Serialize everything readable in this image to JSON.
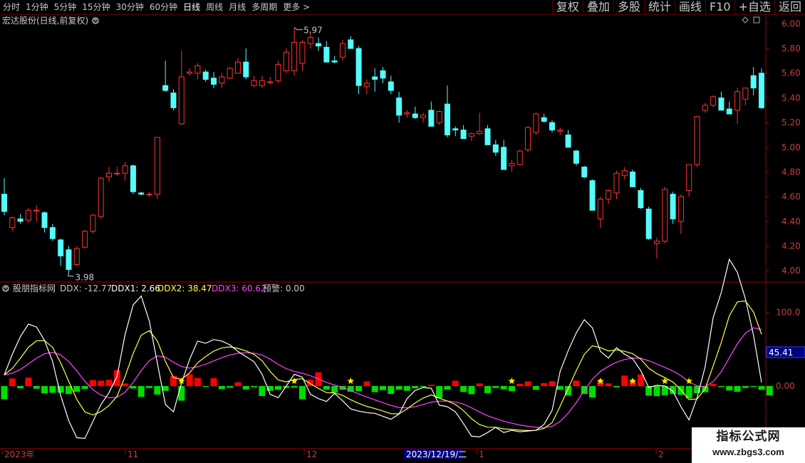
{
  "toolbar": {
    "periods": [
      "分时",
      "1分钟",
      "5分钟",
      "15分钟",
      "30分钟",
      "60分钟",
      "日线",
      "周线",
      "月线",
      "多周期",
      "更多"
    ],
    "active_period": "日线",
    "right_buttons": [
      "复权",
      "叠加",
      "多股",
      "统计",
      "画线",
      "F10",
      "+自选",
      "返回"
    ]
  },
  "stock_title": "宏达股份(日线,前复权)",
  "indicator": {
    "name": "股朋指标网",
    "ddx_label": "DDX: -12.77",
    "ddx1_label": "DDX1: 2.66",
    "ddx2_label": "DDX2: 38.47",
    "ddx3_label": "DDX3: 60.62",
    "alert_label": "预警: 0.00",
    "current_value": "45.41"
  },
  "colors": {
    "up": "#ff3232",
    "down": "#54fcfc",
    "ddx1": "#ffffff",
    "ddx2": "#ffff44",
    "ddx3": "#ff44ff",
    "bar_up": "#ff0000",
    "bar_down": "#00dd00",
    "axis": "#a00000"
  },
  "price_axis": [
    "6.00",
    "5.80",
    "5.60",
    "5.40",
    "5.20",
    "5.00",
    "4.80",
    "4.60",
    "4.40",
    "4.20",
    "4.00"
  ],
  "indicator_axis": [
    "100.0",
    "0.00"
  ],
  "annotations": {
    "high": "5.97",
    "low": "3.98"
  },
  "date_axis": {
    "labels": [
      "2023年",
      "11",
      "12",
      "1",
      "2"
    ],
    "cursor_date": "2023/12/19/二"
  },
  "watermark": {
    "line1": "指标公式网",
    "line2": "www.zbgs3.com"
  },
  "chart_data": [
    {
      "type": "candlestick",
      "title": "宏达股份(日线,前复权)",
      "ylim": [
        3.92,
        6.06
      ],
      "candles": [
        [
          4.62,
          4.75,
          4.45,
          4.48
        ],
        [
          4.35,
          4.44,
          4.32,
          4.43
        ],
        [
          4.42,
          4.46,
          4.38,
          4.4
        ],
        [
          4.41,
          4.51,
          4.39,
          4.49
        ],
        [
          4.49,
          4.53,
          4.4,
          4.49
        ],
        [
          4.47,
          4.48,
          4.31,
          4.35
        ],
        [
          4.35,
          4.38,
          4.24,
          4.26
        ],
        [
          4.25,
          4.26,
          4.04,
          4.12
        ],
        [
          4.17,
          4.2,
          3.98,
          4.01
        ],
        [
          4.05,
          4.2,
          4.04,
          4.18
        ],
        [
          4.19,
          4.33,
          4.18,
          4.32
        ],
        [
          4.32,
          4.46,
          4.3,
          4.45
        ],
        [
          4.44,
          4.76,
          4.42,
          4.75
        ],
        [
          4.76,
          4.84,
          4.72,
          4.79
        ],
        [
          4.79,
          4.84,
          4.77,
          4.79
        ],
        [
          4.79,
          4.88,
          4.73,
          4.85
        ],
        [
          4.85,
          4.86,
          4.62,
          4.64
        ],
        [
          4.63,
          4.64,
          4.61,
          4.62
        ],
        [
          4.62,
          4.64,
          4.6,
          4.62
        ],
        [
          4.62,
          5.08,
          4.58,
          5.08
        ],
        [
          5.5,
          5.7,
          5.45,
          5.46
        ],
        [
          5.44,
          5.47,
          5.3,
          5.32
        ],
        [
          5.19,
          5.78,
          5.18,
          5.57
        ],
        [
          5.6,
          5.64,
          5.58,
          5.61
        ],
        [
          5.6,
          5.68,
          5.55,
          5.66
        ],
        [
          5.61,
          5.63,
          5.53,
          5.55
        ],
        [
          5.56,
          5.61,
          5.48,
          5.51
        ],
        [
          5.52,
          5.6,
          5.48,
          5.57
        ],
        [
          5.56,
          5.65,
          5.55,
          5.64
        ],
        [
          5.6,
          5.72,
          5.6,
          5.69
        ],
        [
          5.69,
          5.8,
          5.55,
          5.57
        ],
        [
          5.5,
          5.58,
          5.49,
          5.54
        ],
        [
          5.5,
          5.58,
          5.48,
          5.54
        ],
        [
          5.53,
          5.57,
          5.51,
          5.53
        ],
        [
          5.54,
          5.7,
          5.52,
          5.67
        ],
        [
          5.62,
          5.8,
          5.6,
          5.77
        ],
        [
          5.62,
          5.97,
          5.58,
          5.85
        ],
        [
          5.68,
          5.87,
          5.62,
          5.85
        ],
        [
          5.84,
          5.94,
          5.8,
          5.89
        ],
        [
          5.84,
          5.89,
          5.78,
          5.82
        ],
        [
          5.81,
          5.86,
          5.71,
          5.69
        ],
        [
          5.7,
          5.74,
          5.68,
          5.69
        ],
        [
          5.73,
          5.87,
          5.7,
          5.84
        ],
        [
          5.87,
          5.9,
          5.8,
          5.8
        ],
        [
          5.8,
          5.82,
          5.43,
          5.5
        ],
        [
          5.49,
          5.55,
          5.43,
          5.52
        ],
        [
          5.57,
          5.64,
          5.45,
          5.55
        ],
        [
          5.62,
          5.65,
          5.52,
          5.56
        ],
        [
          5.53,
          5.58,
          5.43,
          5.46
        ],
        [
          5.4,
          5.45,
          5.2,
          5.26
        ],
        [
          5.27,
          5.3,
          5.24,
          5.28
        ],
        [
          5.27,
          5.33,
          5.23,
          5.24
        ],
        [
          5.24,
          5.28,
          5.2,
          5.26
        ],
        [
          5.3,
          5.37,
          5.17,
          5.17
        ],
        [
          5.2,
          5.3,
          5.18,
          5.29
        ],
        [
          5.35,
          5.5,
          5.08,
          5.1
        ],
        [
          5.15,
          5.17,
          5.09,
          5.14
        ],
        [
          5.14,
          5.18,
          5.08,
          5.07
        ],
        [
          5.09,
          5.12,
          5.05,
          5.11
        ],
        [
          5.11,
          5.28,
          5.1,
          5.13
        ],
        [
          5.15,
          5.18,
          5.02,
          5.02
        ],
        [
          5.02,
          5.06,
          4.93,
          4.96
        ],
        [
          5.0,
          5.06,
          4.82,
          4.82
        ],
        [
          4.85,
          4.9,
          4.8,
          4.87
        ],
        [
          4.86,
          4.98,
          4.85,
          4.97
        ],
        [
          4.98,
          5.17,
          4.96,
          5.16
        ],
        [
          5.12,
          5.28,
          5.1,
          5.27
        ],
        [
          5.24,
          5.27,
          5.2,
          5.21
        ],
        [
          5.2,
          5.22,
          5.12,
          5.14
        ],
        [
          5.13,
          5.16,
          5.1,
          5.14
        ],
        [
          5.1,
          5.14,
          5.0,
          5.0
        ],
        [
          4.97,
          4.98,
          4.85,
          4.87
        ],
        [
          4.84,
          4.85,
          4.75,
          4.76
        ],
        [
          4.73,
          4.74,
          4.49,
          4.49
        ],
        [
          4.42,
          4.6,
          4.35,
          4.58
        ],
        [
          4.58,
          4.66,
          4.54,
          4.65
        ],
        [
          4.63,
          4.81,
          4.58,
          4.79
        ],
        [
          4.77,
          4.84,
          4.74,
          4.81
        ],
        [
          4.8,
          4.82,
          4.68,
          4.68
        ],
        [
          4.65,
          4.67,
          4.5,
          4.51
        ],
        [
          4.5,
          4.52,
          4.25,
          4.26
        ],
        [
          4.22,
          4.27,
          4.1,
          4.24
        ],
        [
          4.24,
          4.68,
          4.22,
          4.66
        ],
        [
          4.62,
          4.64,
          4.38,
          4.42
        ],
        [
          4.4,
          4.62,
          4.3,
          4.6
        ],
        [
          4.65,
          4.86,
          4.6,
          4.86
        ],
        [
          4.86,
          5.25,
          4.84,
          5.25
        ],
        [
          5.3,
          5.36,
          5.28,
          5.34
        ],
        [
          5.34,
          5.42,
          5.32,
          5.41
        ],
        [
          5.4,
          5.45,
          5.3,
          5.3
        ],
        [
          5.31,
          5.37,
          5.27,
          5.27
        ],
        [
          5.3,
          5.48,
          5.19,
          5.45
        ],
        [
          5.39,
          5.46,
          5.34,
          5.48
        ],
        [
          5.58,
          5.65,
          5.42,
          5.48
        ],
        [
          5.6,
          5.64,
          5.31,
          5.32
        ]
      ]
    },
    {
      "type": "bar+line",
      "ylim": [
        -85,
        140
      ],
      "ddx_bars": [
        -17.9,
        10.3,
        -3.1,
        11.4,
        -3.6,
        -9.8,
        -9.2,
        -9.0,
        -10.8,
        -7.7,
        -3.9,
        8.3,
        7.3,
        8.5,
        21.5,
        3.5,
        -3.4,
        -14.7,
        -2.6,
        -11.5,
        -6.5,
        13.7,
        -19.8,
        16.0,
        11.1,
        -1.2,
        10.6,
        -4.2,
        -2.3,
        5.2,
        -4.6,
        -1.6,
        -13.5,
        -6.5,
        -5.1,
        -2.5,
        -2.1,
        -17.9,
        8.9,
        18.6,
        -4.8,
        -8.7,
        -5.0,
        -7.7,
        -6.9,
        6.3,
        -8.2,
        -5.6,
        -10.7,
        -5.0,
        -6.5,
        -3.0,
        -1.3,
        1.7,
        -16.4,
        -4.8,
        7.2,
        -8.1,
        -11.0,
        3.5,
        -9.6,
        -2.6,
        -4.4,
        -6.9,
        2.9,
        6.3,
        -5.1,
        4.1,
        6.6,
        -5.0,
        -12.7,
        7.4,
        -10.7,
        -15.5,
        6.8,
        3.5,
        -1.7,
        14.2,
        7.1,
        15.6,
        -13.0,
        -13.7,
        -12.4,
        -10.7,
        -12.0,
        -16.6,
        -9.7,
        -8.4,
        3.1,
        -1.3,
        -6.0,
        -7.7,
        -2.5,
        -1.4,
        -5.1,
        -12.7
      ],
      "ddx1_line": [
        15,
        43,
        67,
        84,
        80,
        62,
        33,
        -13,
        -47,
        -70,
        -71,
        -48,
        -25,
        -9,
        13,
        70,
        110,
        122,
        88,
        31,
        -25,
        -35,
        4,
        36,
        61,
        58,
        63,
        61,
        56,
        47,
        40,
        33,
        16,
        -11,
        -16,
        0,
        16,
        12,
        -11,
        -17,
        -21,
        -10,
        -20,
        -31,
        -34,
        -36,
        -37,
        -41,
        -45,
        -38,
        -17,
        -6,
        -2,
        -3,
        -26,
        -28,
        -35,
        -51,
        -68,
        -69,
        -63,
        -56,
        -63,
        -60,
        -62,
        -61,
        -60,
        -52,
        -33,
        20,
        48,
        72,
        90,
        79,
        47,
        38,
        52,
        43,
        37,
        21,
        -2,
        1,
        0,
        -7,
        -28,
        -46,
        -16,
        26,
        93,
        127,
        172,
        154,
        118,
        69,
        5
      ]
    }
  ]
}
